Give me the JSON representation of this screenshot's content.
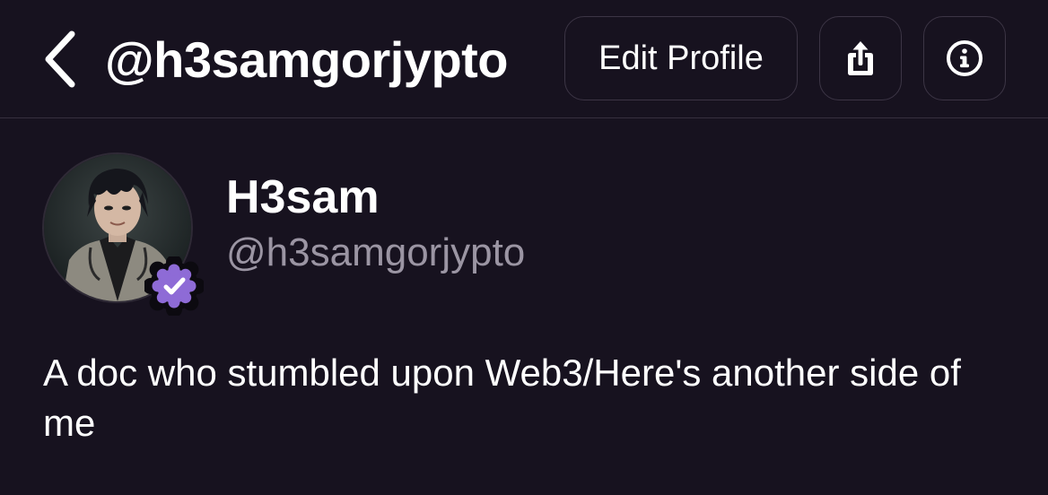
{
  "header": {
    "title": "@h3samgorjypto",
    "edit_profile_label": "Edit Profile",
    "icons": {
      "back": "chevron-left-icon",
      "share": "share-icon",
      "info": "info-icon"
    }
  },
  "profile": {
    "display_name": "H3sam",
    "handle": "@h3samgorjypto",
    "bio": "A doc who stumbled upon Web3/Here's another side of me",
    "verified": true,
    "avatar_alt": "avatar-image"
  },
  "colors": {
    "background": "#17121f",
    "border": "#3c3545",
    "text_primary": "#ffffff",
    "text_secondary": "#9b95a3",
    "verified_badge": "#8e6bd6"
  }
}
